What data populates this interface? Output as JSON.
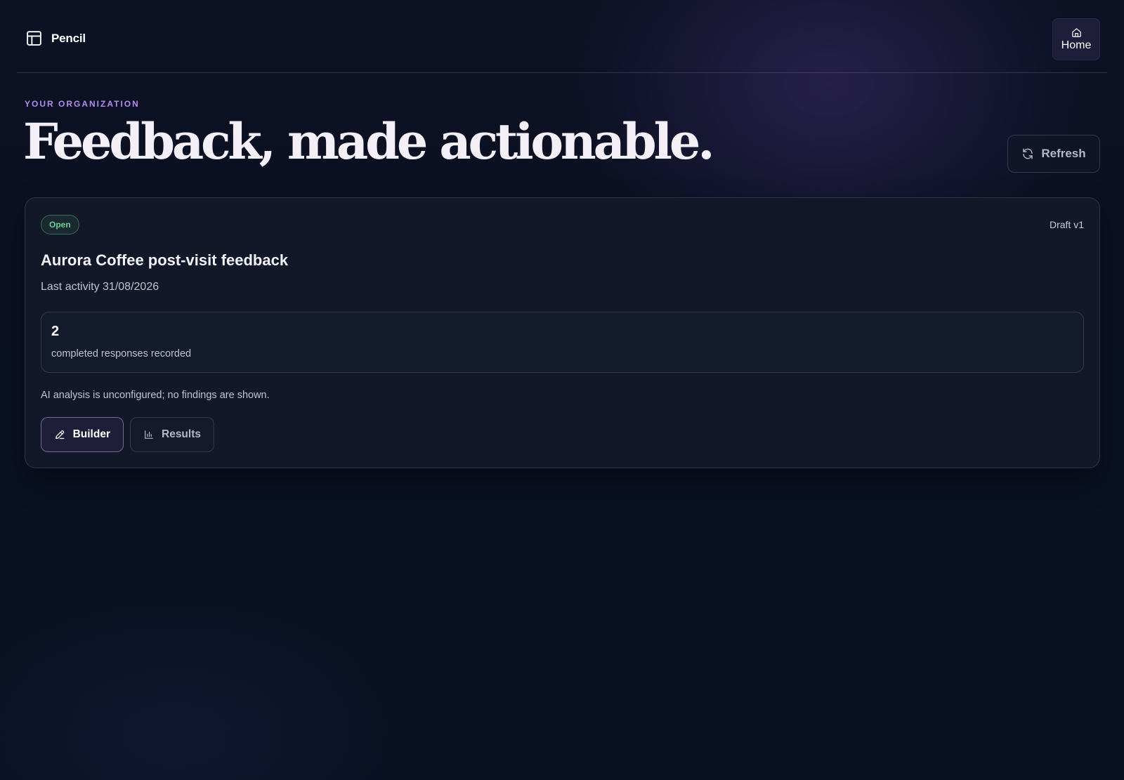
{
  "header": {
    "brand_name": "Pencil",
    "brand_icon": "layout-icon",
    "home_label": "Home",
    "home_icon": "home-icon"
  },
  "hero": {
    "eyebrow": "YOUR ORGANIZATION",
    "title": "Feedback, made actionable.",
    "refresh_label": "Refresh",
    "refresh_icon": "refresh-icon"
  },
  "survey": {
    "status": "Open",
    "status_color": "#6fce94",
    "version": "Draft v1",
    "title": "Aurora Coffee post-visit feedback",
    "last_activity": "Last activity 31/08/2026",
    "responses_count": "2",
    "responses_label": "completed responses recorded",
    "ai_note": "AI analysis is unconfigured; no findings are shown.",
    "actions": {
      "builder_label": "Builder",
      "builder_icon": "pencil-icon",
      "results_label": "Results",
      "results_icon": "bar-chart-icon"
    }
  },
  "colors": {
    "background": "#0a1122",
    "accent": "#b38cf0",
    "card": "#121828"
  }
}
